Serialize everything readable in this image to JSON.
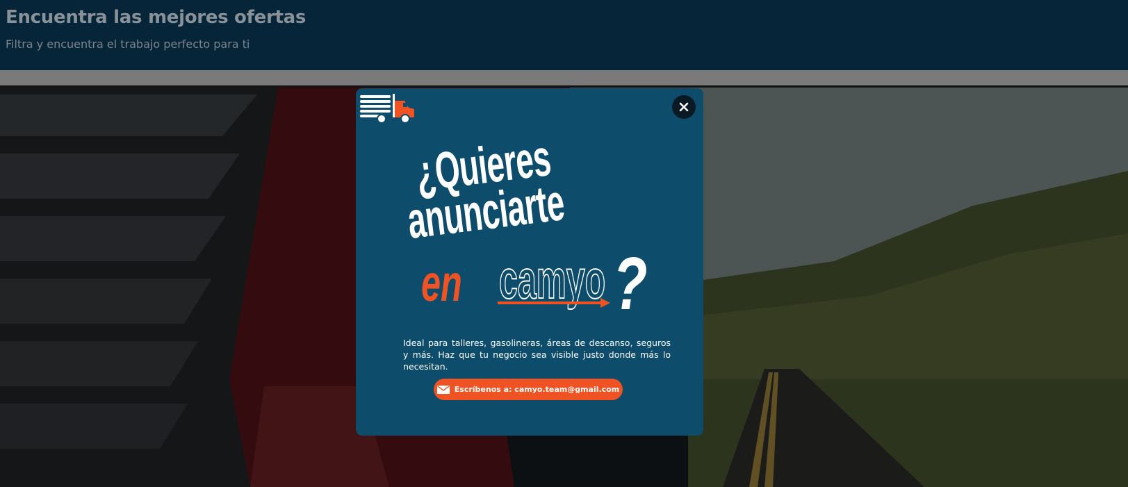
{
  "header": {
    "title": "Encuentra las mejores ofertas",
    "subtitle": "Filtra y encuentra el trabajo perfecto para ti"
  },
  "modal": {
    "headline_line1": "¿Quieres",
    "headline_line2": "anunciarte",
    "headline_en": "en",
    "headline_brand": "camyo",
    "headline_question": "?",
    "description": "Ideal para talleres, gasolineras, áreas de descanso, seguros y más. Haz que tu negocio sea visible justo donde más lo necesitan.",
    "cta_label": "Escríbenos a: camyo.team@gmail.com",
    "icons": {
      "logo": "truck-logo-icon",
      "close": "close-icon",
      "mail": "mail-icon"
    }
  },
  "colors": {
    "header_bg": "#062538",
    "modal_bg": "#0d4c6b",
    "accent": "#f05323",
    "close_bg": "#0a1a24"
  }
}
